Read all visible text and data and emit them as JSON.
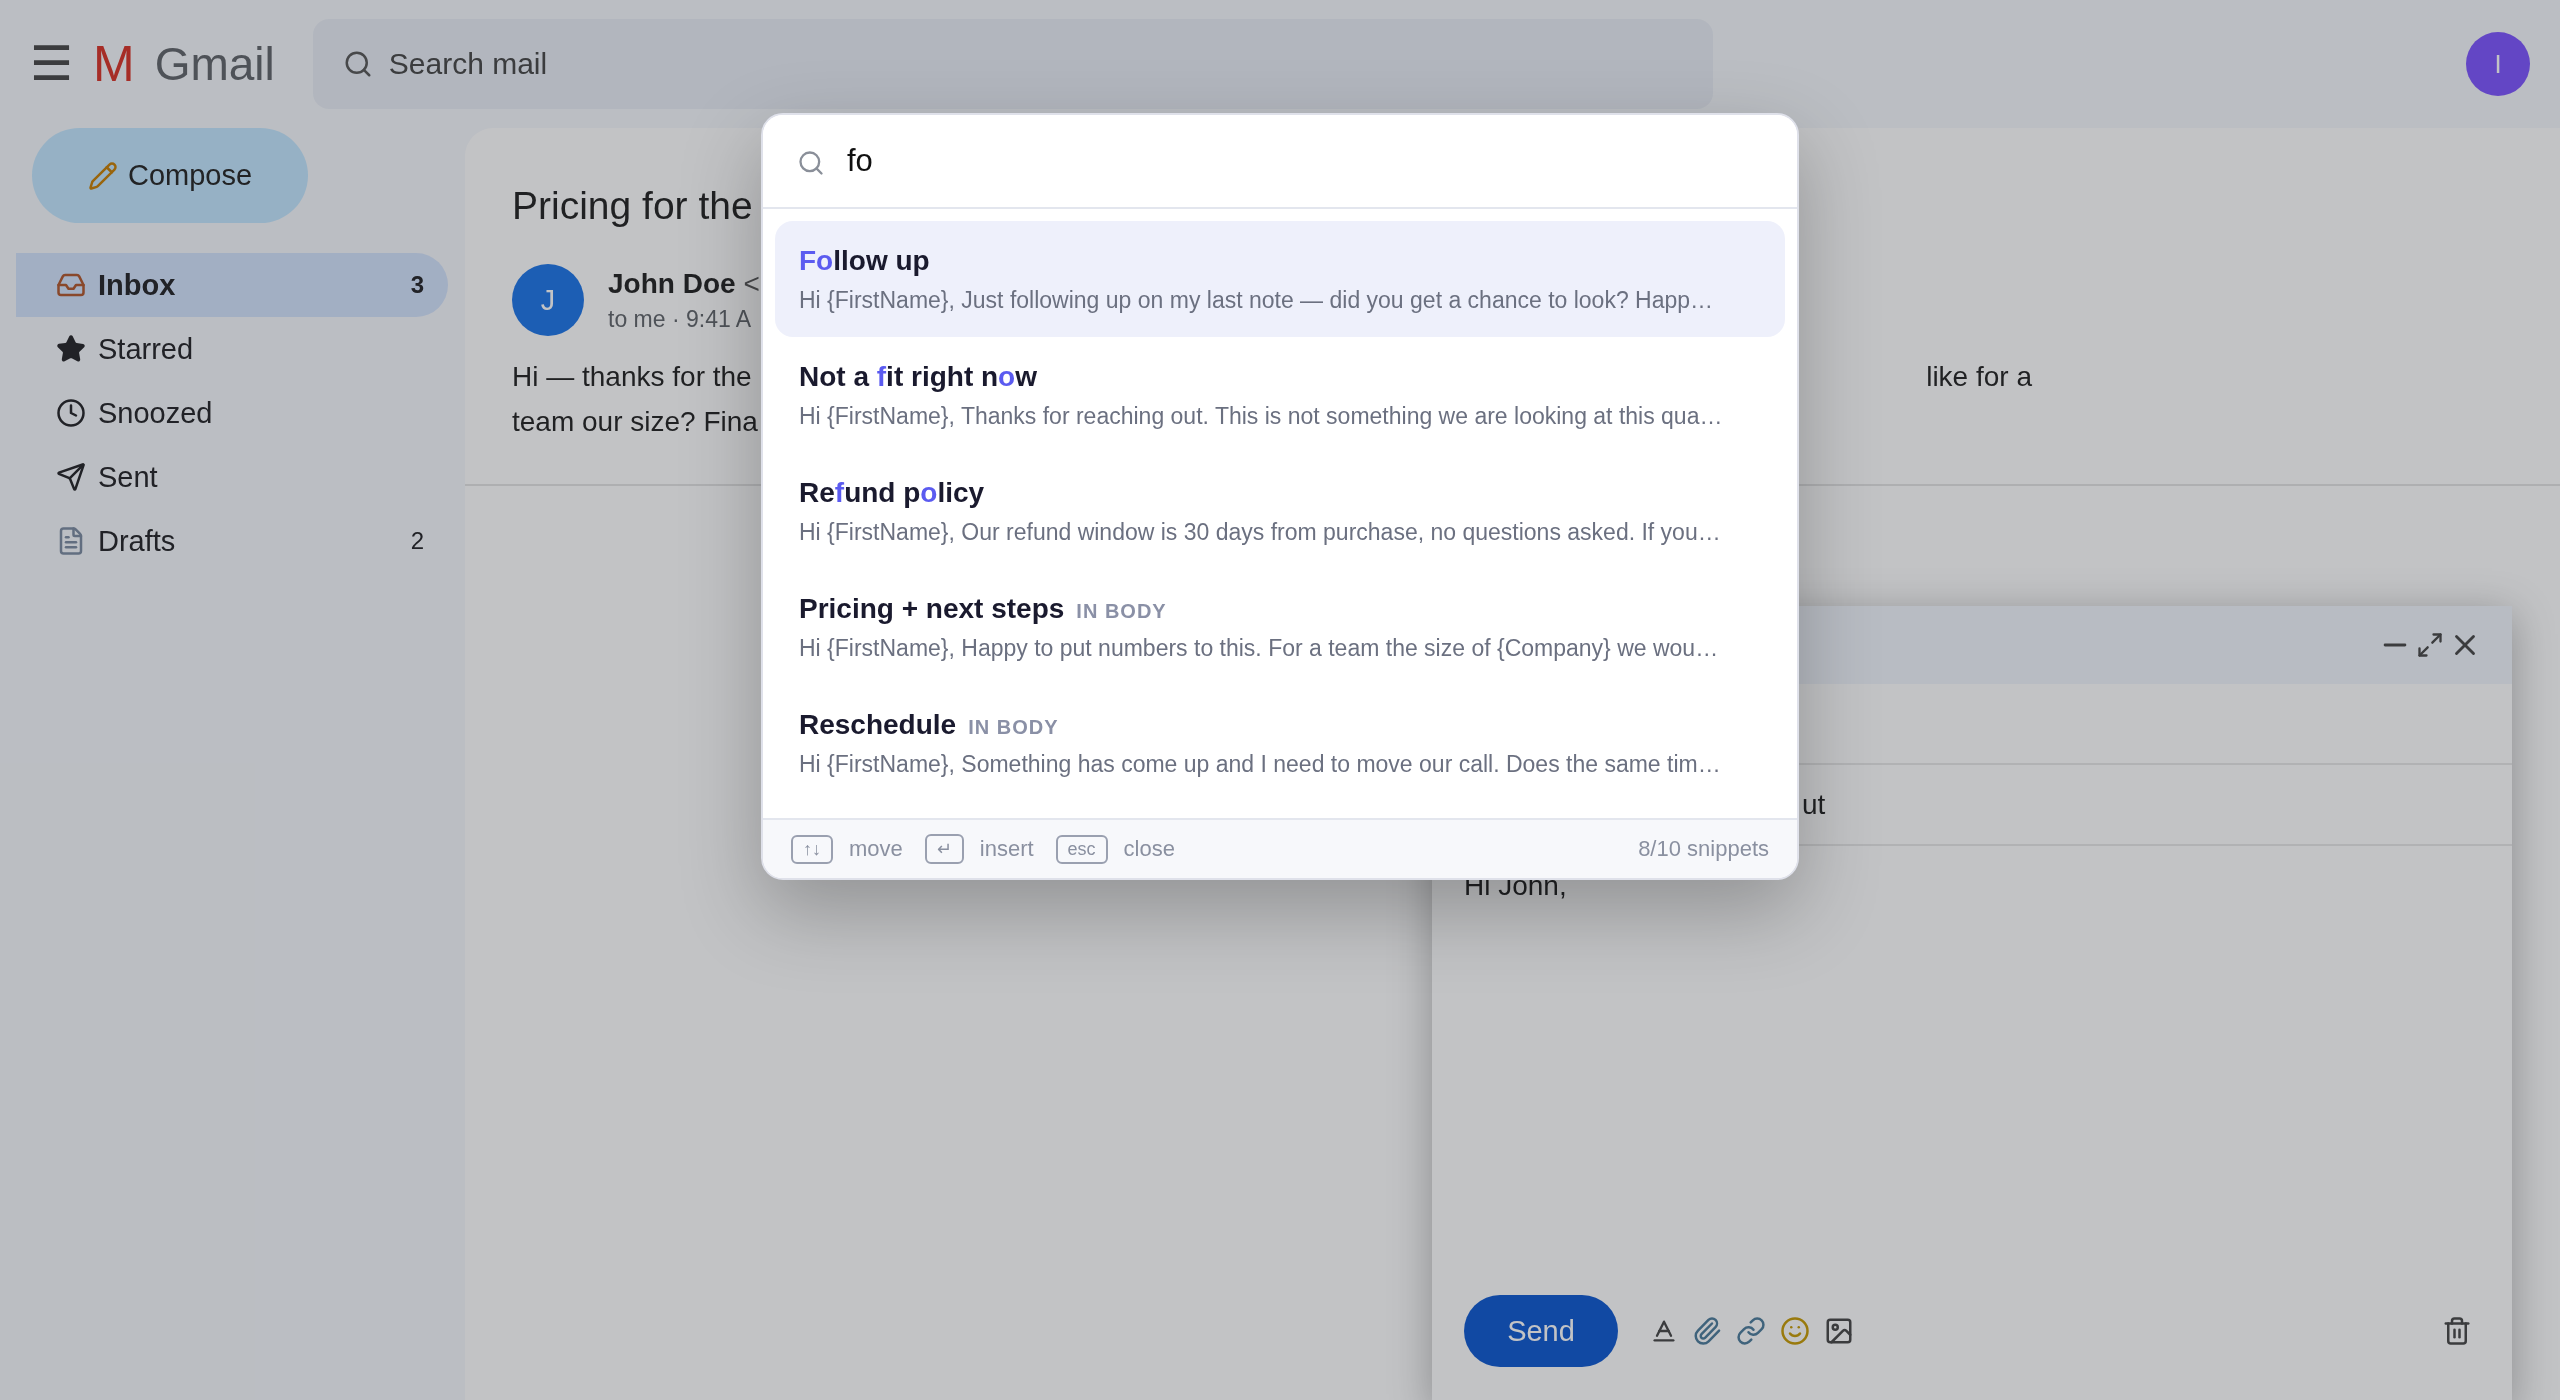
{
  "header": {
    "menu_icon": "☰",
    "logo_mark": "M",
    "logo_text": "Gmail",
    "search": {
      "placeholder": "Search mail"
    },
    "avatar": "I"
  },
  "sidebar": {
    "compose": "Compose",
    "items": [
      {
        "kind": "inbox",
        "label": "Inbox",
        "count": "3",
        "selected": true
      },
      {
        "kind": "starred",
        "label": "Starred",
        "selected": false
      },
      {
        "kind": "snoozed",
        "label": "Snoozed",
        "selected": false
      },
      {
        "kind": "sent",
        "label": "Sent",
        "selected": false
      },
      {
        "kind": "drafts",
        "label": "Drafts",
        "count": "2",
        "selected": false
      }
    ]
  },
  "email": {
    "subject": "Pricing for the",
    "sender_avatar": "J",
    "sender_name": "John Doe",
    "sender_email": "<",
    "meta": "to me · 9:41 A",
    "body_line_1_start": "Hi — thanks for the",
    "body_line_1_end": "like for a",
    "body_line_2": "team our size? Fina"
  },
  "compose": {
    "subject_fragment": "ut",
    "body": "Hi John,",
    "send": "Send"
  },
  "snippet_picker": {
    "query": "fo",
    "items": [
      {
        "selected": true,
        "title": [
          {
            "text": "Fo",
            "match": true
          },
          {
            "text": "llow up",
            "match": false
          }
        ],
        "preview": "Hi {FirstName}, Just following up on my last note — did you get a chance to look? Happ…"
      },
      {
        "selected": false,
        "title": [
          {
            "text": "Not a ",
            "match": false
          },
          {
            "text": "f",
            "match": true
          },
          {
            "text": "it right n",
            "match": false
          },
          {
            "text": "o",
            "match": true
          },
          {
            "text": "w",
            "match": false
          }
        ],
        "preview": "Hi {FirstName}, Thanks for reaching out. This is not something we are looking at this qua…"
      },
      {
        "selected": false,
        "title": [
          {
            "text": "Re",
            "match": false
          },
          {
            "text": "f",
            "match": true
          },
          {
            "text": "und p",
            "match": false
          },
          {
            "text": "o",
            "match": true
          },
          {
            "text": "licy",
            "match": false
          }
        ],
        "preview": "Hi {FirstName}, Our refund window is 30 days from purchase, no questions asked. If you…"
      },
      {
        "selected": false,
        "title": [
          {
            "text": "Pricing + next steps",
            "match": false
          }
        ],
        "tag": "IN BODY",
        "preview": "Hi {FirstName}, Happy to put numbers to this. For a team the size of {Company} we wou…"
      },
      {
        "selected": false,
        "title": [
          {
            "text": "Reschedule",
            "match": false
          }
        ],
        "tag": "IN BODY",
        "preview": "Hi {FirstName}, Something has come up and I need to move our call. Does the same tim…"
      }
    ],
    "hints": [
      {
        "key": "↑↓",
        "label": "move"
      },
      {
        "key": "↵",
        "label": "insert"
      },
      {
        "key": "esc",
        "label": "close"
      }
    ],
    "count": "8/10 snippets"
  }
}
